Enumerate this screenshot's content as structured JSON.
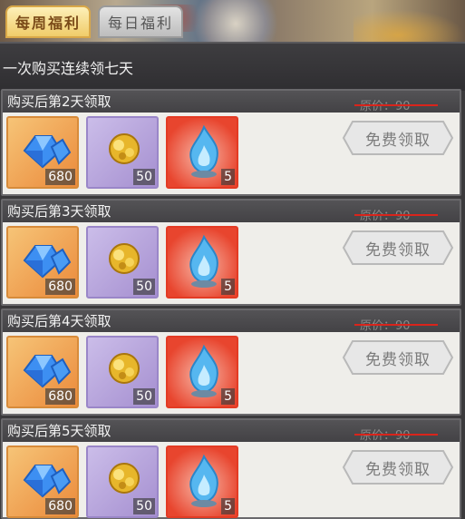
{
  "tabs": [
    {
      "label": "每周福利"
    },
    {
      "label": "每日福利"
    }
  ],
  "header": {
    "text": "一次购买连续领七天"
  },
  "cards": [
    {
      "title": "购买后第2天领取",
      "items": [
        {
          "icon": "blue-diamond-icon",
          "count": "680"
        },
        {
          "icon": "gold-ore-icon",
          "count": "50"
        },
        {
          "icon": "blue-flame-icon",
          "count": "5"
        }
      ],
      "price": "原价：90",
      "button": "免费领取"
    },
    {
      "title": "购买后第3天领取",
      "items": [
        {
          "icon": "blue-diamond-icon",
          "count": "680"
        },
        {
          "icon": "gold-ore-icon",
          "count": "50"
        },
        {
          "icon": "blue-flame-icon",
          "count": "5"
        }
      ],
      "price": "原价：90",
      "button": "免费领取"
    },
    {
      "title": "购买后第4天领取",
      "items": [
        {
          "icon": "blue-diamond-icon",
          "count": "680"
        },
        {
          "icon": "gold-ore-icon",
          "count": "50"
        },
        {
          "icon": "blue-flame-icon",
          "count": "5"
        }
      ],
      "price": "原价：90",
      "button": "免费领取"
    },
    {
      "title": "购买后第5天领取",
      "items": [
        {
          "icon": "blue-diamond-icon",
          "count": "680"
        },
        {
          "icon": "gold-ore-icon",
          "count": "50"
        },
        {
          "icon": "blue-flame-icon",
          "count": "5"
        }
      ],
      "price": "原价：90",
      "button": "免费领取"
    }
  ],
  "colors": {
    "active_tab": "#f0cc6a",
    "strike": "#d9241b",
    "card_bg": "#efeeea"
  }
}
